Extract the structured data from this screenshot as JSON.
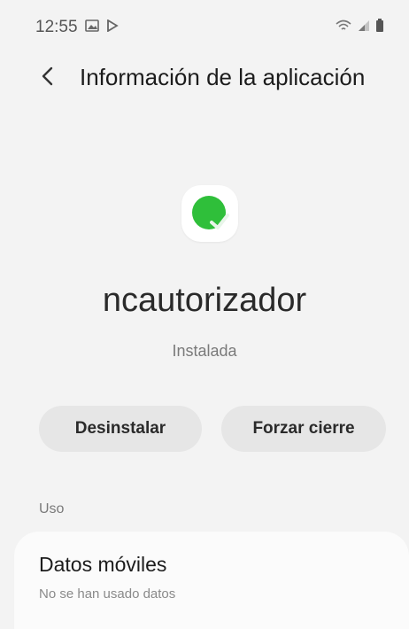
{
  "status_bar": {
    "time": "12:55",
    "left_icons": [
      "gallery-icon",
      "play-store-icon"
    ],
    "right_icons": [
      "wifi-icon",
      "signal-icon",
      "battery-icon"
    ]
  },
  "header": {
    "back_icon": "back-arrow-icon",
    "title": "Información de la aplicación"
  },
  "app": {
    "icon": "green-check-icon",
    "name": "ncautorizador",
    "status": "Instalada"
  },
  "actions": {
    "uninstall_label": "Desinstalar",
    "force_stop_label": "Forzar cierre"
  },
  "usage": {
    "section_label": "Uso",
    "mobile_data": {
      "title": "Datos móviles",
      "subtitle": "No se han usado datos"
    }
  },
  "colors": {
    "background": "#f3f3f3",
    "button": "#e6e6e6",
    "card": "#fbfbfb",
    "app_icon_green": "#2fbf3a"
  }
}
